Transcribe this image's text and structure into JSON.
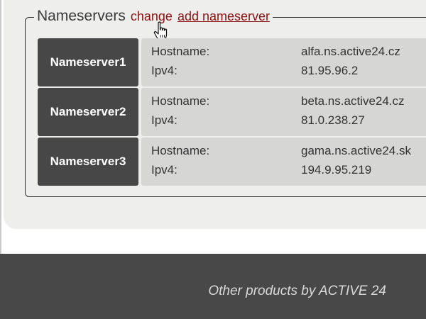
{
  "nameservers": {
    "title": "Nameservers",
    "change_label": "change",
    "add_label": "add nameserver",
    "items": [
      {
        "label": "Nameserver1",
        "hostname_key": "Hostname:",
        "hostname": "alfa.ns.active24.cz",
        "ipv4_key": "Ipv4:",
        "ipv4": "81.95.96.2"
      },
      {
        "label": "Nameserver2",
        "hostname_key": "Hostname:",
        "hostname": "beta.ns.active24.cz",
        "ipv4_key": "Ipv4:",
        "ipv4": "81.0.238.27"
      },
      {
        "label": "Nameserver3",
        "hostname_key": "Hostname:",
        "hostname": "gama.ns.active24.sk",
        "ipv4_key": "Ipv4:",
        "ipv4": "194.9.95.219"
      }
    ]
  },
  "footer": {
    "link_text": "Other products by ACTIVE 24"
  },
  "colors": {
    "link": "#8a1212",
    "label_bg": "#474747",
    "details_bg": "#d6d6d4",
    "panel_bg": "#eeeeec",
    "footer_bg": "#484848"
  },
  "icons": {
    "cursor": "hand-pointer-cursor-icon"
  }
}
